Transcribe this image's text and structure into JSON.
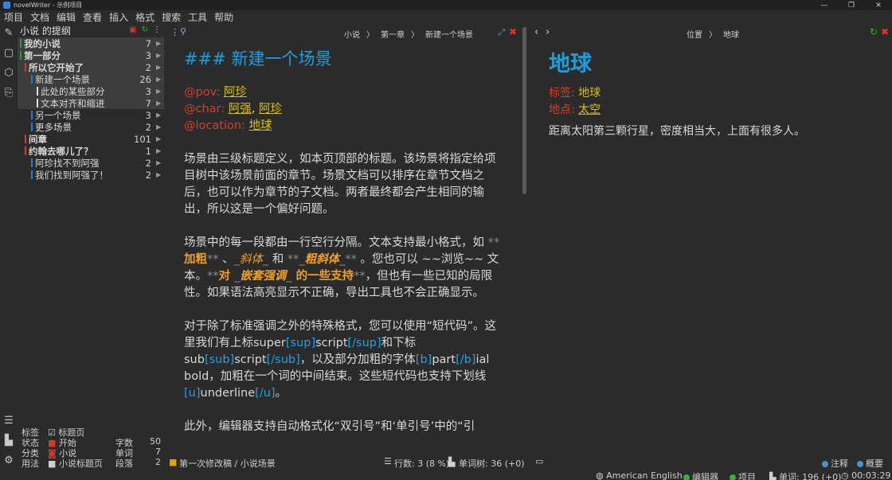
{
  "window": {
    "title": "novelWriter - 示例项目"
  },
  "menu": [
    "项目",
    "文档",
    "编辑",
    "查看",
    "插入",
    "格式",
    "搜索",
    "工具",
    "帮助"
  ],
  "tree": {
    "title": "小说 的提纲",
    "items": [
      {
        "label": "我的小说",
        "count": "7",
        "bar": "#2a9a3a",
        "bold": true,
        "indent": 0
      },
      {
        "label": "第一部分",
        "count": "3",
        "bar": "#2a9a3a",
        "bold": true,
        "indent": 0
      },
      {
        "label": "所以它开始了",
        "count": "2",
        "bar": "#d03a2a",
        "bold": true,
        "indent": 6
      },
      {
        "label": "新建一个场景",
        "count": "26",
        "bar": "#2c79d0",
        "bold": false,
        "indent": 14
      },
      {
        "label": "此处的某些部分",
        "count": "3",
        "bar": "#e0e0e0",
        "bold": false,
        "indent": 21
      },
      {
        "label": "文本对齐和缩进",
        "count": "7",
        "bar": "#e0e0e0",
        "bold": false,
        "indent": 21
      },
      {
        "label": "另一个场景",
        "count": "3",
        "bar": "#2c79d0",
        "bold": false,
        "indent": 14
      },
      {
        "label": "更多场景",
        "count": "2",
        "bar": "#2c79d0",
        "bold": false,
        "indent": 14
      },
      {
        "label": "间章",
        "count": "101",
        "bar": "#d03a2a",
        "bold": true,
        "indent": 6
      },
      {
        "label": "约翰去哪儿了？",
        "count": "1",
        "bar": "#d03a2a",
        "bold": true,
        "indent": 6
      },
      {
        "label": "阿珍找不到阿强",
        "count": "2",
        "bar": "#2c79d0",
        "bold": false,
        "indent": 14
      },
      {
        "label": "我们找到阿强了！",
        "count": "2",
        "bar": "#2c79d0",
        "bold": false,
        "indent": 14
      }
    ]
  },
  "legend": {
    "col1": [
      "标签",
      "状态",
      "分类",
      "用法"
    ],
    "col2": [
      {
        "text": "标题页",
        "color": "#cfcfcf",
        "mark": "☑"
      },
      {
        "text": "开始",
        "color": "#d03a2a",
        "mark": "■"
      },
      {
        "text": "小说",
        "color": "#d03a2a",
        "mark": "◙"
      },
      {
        "text": "小说标题页",
        "color": "#cfcfcf",
        "mark": "■"
      }
    ],
    "col3": [
      "字数",
      "单词",
      "段落"
    ],
    "col4": [
      "50",
      "7",
      "2"
    ]
  },
  "editor": {
    "breadcrumb": [
      "小说",
      "〉",
      "第一章",
      "〉",
      "新建一个场景"
    ],
    "heading_marker": "###",
    "heading_text": "新建一个场景",
    "meta": [
      {
        "key": "@pov",
        "values": [
          "阿珍"
        ]
      },
      {
        "key": "@char",
        "values": [
          "阿强",
          "阿珍"
        ]
      },
      {
        "key": "@location",
        "values": [
          "地球"
        ]
      }
    ],
    "p1": "场景由三级标题定义，如本页顶部的标题。该场景将指定给项目树中该场景前面的章节。场景文档可以排序在章节文档之后，也可以作为章节的子文档。两者最终都会产生相同的输出，所以这是一个偏好问题。",
    "p2": {
      "a": "场景中的每一段都由一行空行分隔。文本支持最小格式，如 ",
      "m_b1": "**",
      "bold": "加粗",
      "m_b2": "**",
      "b": " 、",
      "m_i1": "_",
      "italic": "斜体",
      "m_i2": "_",
      "c": " 和 ",
      "m_bi1": "**_",
      "bolditalic": "粗斜体",
      "m_bi2": "_**",
      "d": " 。您也可以 ~~浏览~~ 文本。",
      "m_n1": "**",
      "n1": "对 ",
      "m_n2": "_",
      "n2": "嵌套强调",
      "m_n3": "_",
      "n3": " 的一些支持",
      "m_n4": "**",
      "e": "，但也有一些已知的局限性。如果语法高亮显示不正确，导出工具也不会正确显示。"
    },
    "p3": {
      "a": "对于除了标准强调之外的特殊格式，您可以使用“短代码”。这里我们有上标super",
      "sup1": "[sup]",
      "b": "script",
      "sup2": "[/sup]",
      "c": "和下标sub",
      "sub1": "[sub]",
      "d": "script",
      "sub2": "[/sub]",
      "e": "，以及部分加粗的字体",
      "b1": "[b]",
      "f": "part",
      "b2": "[/b]",
      "g": "ial bold，加粗在一个词的中间结束。这些短代码也支持下划线",
      "u1": "[u]",
      "h": "underline",
      "u2": "[/u]",
      "i": "。"
    },
    "p4": "此外，编辑器支持自动格式化“双引号”和‘单引号’中的“引"
  },
  "viewer": {
    "breadcrumb": [
      "位置",
      "〉",
      "地球"
    ],
    "title": "地球",
    "tag_label": "标签:",
    "tag_value": "地球",
    "loc_label": "地点:",
    "loc_value": "太空",
    "body": "距离太阳第三颗行星，密度相当大，上面有很多人。"
  },
  "status": {
    "doc_status": "第一次修改稿 / 小说场景",
    "lines": "行数: 3 (8 %)",
    "words": "单词树: 36 (+0)",
    "notes": "注释",
    "overview": "概要"
  },
  "bottom": {
    "language": "American English",
    "editor": "编辑器",
    "project": "项目",
    "wordcount": "单词: 196 (+0)",
    "time": "00:03:29"
  },
  "colors": {
    "accent": "#1a9fd8",
    "meta_key": "#d04030",
    "meta_value": "#d9c000",
    "emphasis": "#f0a020",
    "close": "#e03030",
    "refresh": "#30b040"
  }
}
